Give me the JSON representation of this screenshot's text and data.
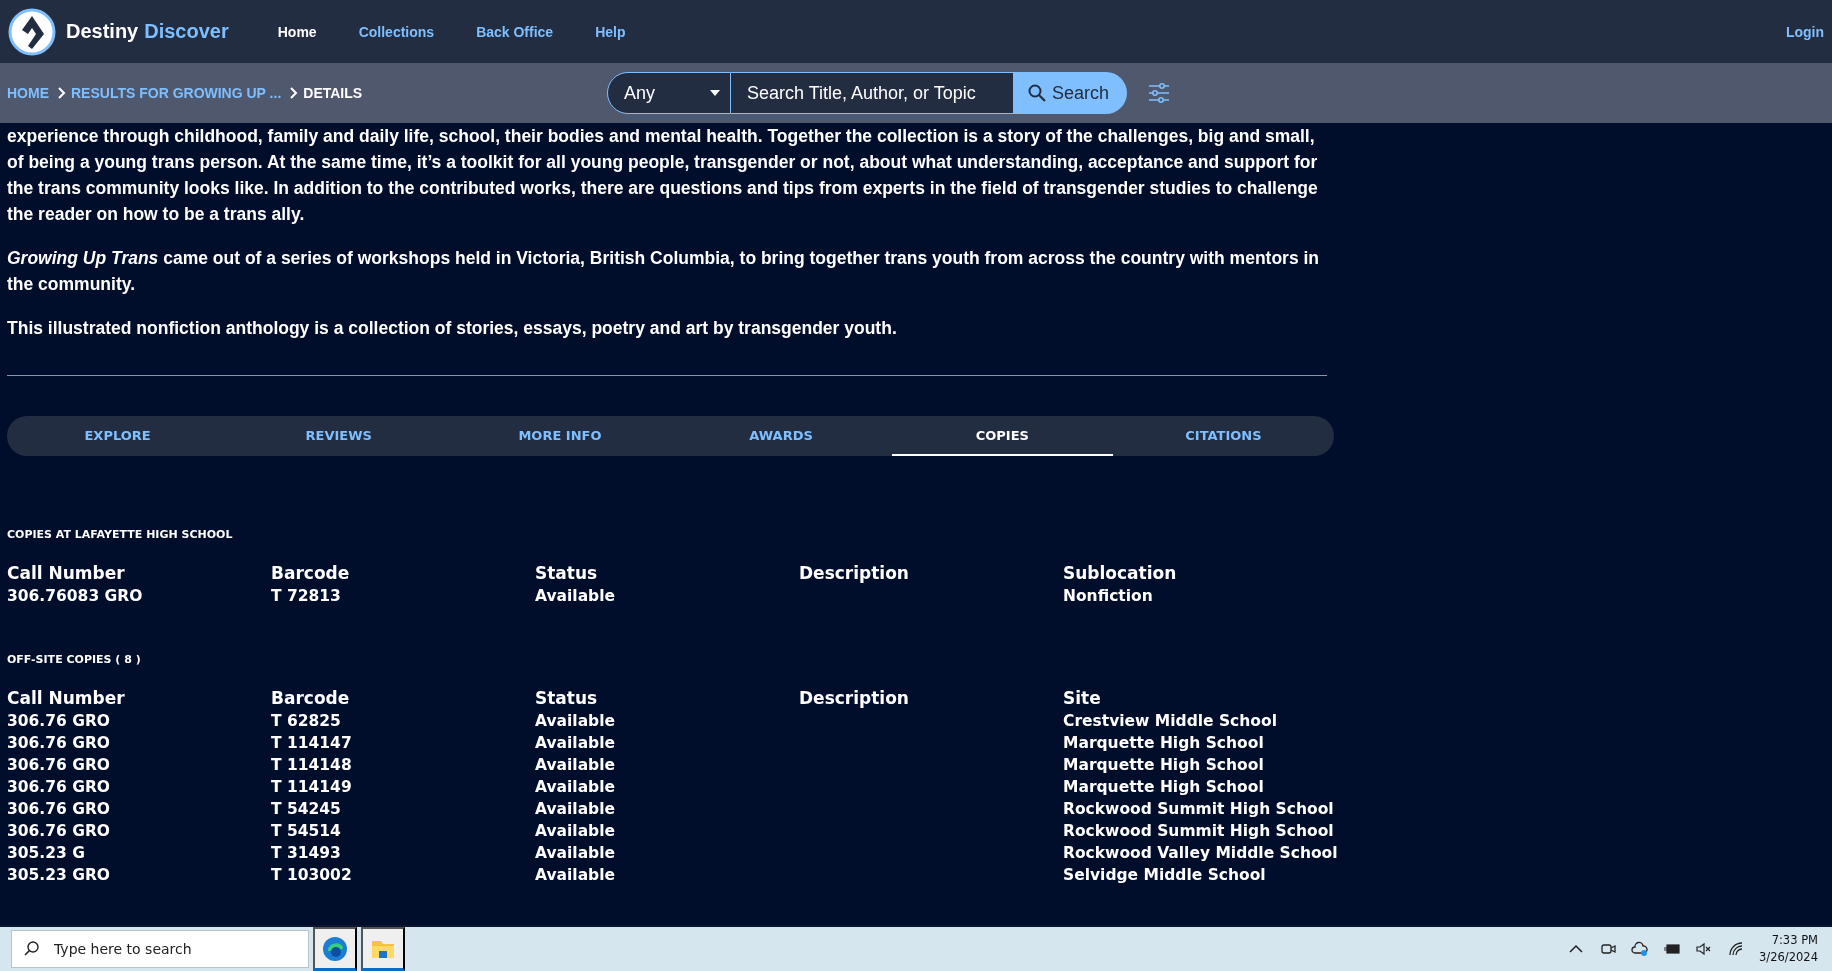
{
  "nav": {
    "logo_word": "Destiny",
    "logo_accent": "Discover",
    "links": [
      {
        "label": "Home",
        "selected": true
      },
      {
        "label": "Collections",
        "selected": false
      },
      {
        "label": "Back Office",
        "selected": false
      },
      {
        "label": "Help",
        "selected": false
      }
    ],
    "login": "Login"
  },
  "breadcrumb": [
    {
      "label": "HOME",
      "current": false
    },
    {
      "label": "RESULTS FOR GROWING UP ...",
      "current": false
    },
    {
      "label": "DETAILS",
      "current": true
    }
  ],
  "search": {
    "scope": "Any",
    "placeholder": "Search Title, Author, or Topic",
    "button": "Search"
  },
  "description": [
    "experience through childhood, family and daily life, school, their bodies and mental health. Together the collection is a story of the challenges, big and small, of being a young trans person. At the same time, it’s a toolkit for all young people, transgender or not, about what understanding, acceptance and support for the trans community looks like. In addition to the contributed works, there are questions and tips from experts in the field of transgender studies to challenge the reader on how to be a trans ally.",
    "*Growing Up Trans* came out of a series of workshops held in Victoria, British Columbia, to bring together trans youth from across the country with mentors in the community.",
    "This illustrated nonfiction anthology is a collection of stories, essays, poetry and art by transgender youth."
  ],
  "tabs": [
    {
      "label": "EXPLORE",
      "selected": false
    },
    {
      "label": "REVIEWS",
      "selected": false
    },
    {
      "label": "MORE INFO",
      "selected": false
    },
    {
      "label": "AWARDS",
      "selected": false
    },
    {
      "label": "COPIES",
      "selected": true
    },
    {
      "label": "CITATIONS",
      "selected": false
    }
  ],
  "copy_sections": [
    {
      "heading": "COPIES AT LAFAYETTE HIGH SCHOOL",
      "columns": [
        "Call Number",
        "Barcode",
        "Status",
        "Description",
        "Sublocation"
      ],
      "rows": [
        [
          "306.76083 GRO",
          "T 72813",
          "Available",
          "",
          "Nonfiction"
        ]
      ]
    },
    {
      "heading": "OFF-SITE COPIES ( 8 )",
      "columns": [
        "Call Number",
        "Barcode",
        "Status",
        "Description",
        "Site"
      ],
      "rows": [
        [
          "306.76 GRO",
          "T 62825",
          "Available",
          "",
          "Crestview Middle School"
        ],
        [
          "306.76 GRO",
          "T 114147",
          "Available",
          "",
          "Marquette High School"
        ],
        [
          "306.76 GRO",
          "T 114148",
          "Available",
          "",
          "Marquette High School"
        ],
        [
          "306.76 GRO",
          "T 114149",
          "Available",
          "",
          "Marquette High School"
        ],
        [
          "306.76 GRO",
          "T 54245",
          "Available",
          "",
          "Rockwood Summit High School"
        ],
        [
          "306.76 GRO",
          "T 54514",
          "Available",
          "",
          "Rockwood Summit High School"
        ],
        [
          "305.23 G",
          "T 31493",
          "Available",
          "",
          "Rockwood Valley Middle School"
        ],
        [
          "305.23 GRO",
          "T 103002",
          "Available",
          "",
          "Selvidge Middle School"
        ]
      ]
    }
  ],
  "taskbar": {
    "search_placeholder": "Type here to search",
    "apps": [
      {
        "kind": "browser",
        "active": true
      },
      {
        "kind": "folder",
        "active": true
      }
    ],
    "time": "7:33 PM",
    "date": "3/26/2024"
  }
}
